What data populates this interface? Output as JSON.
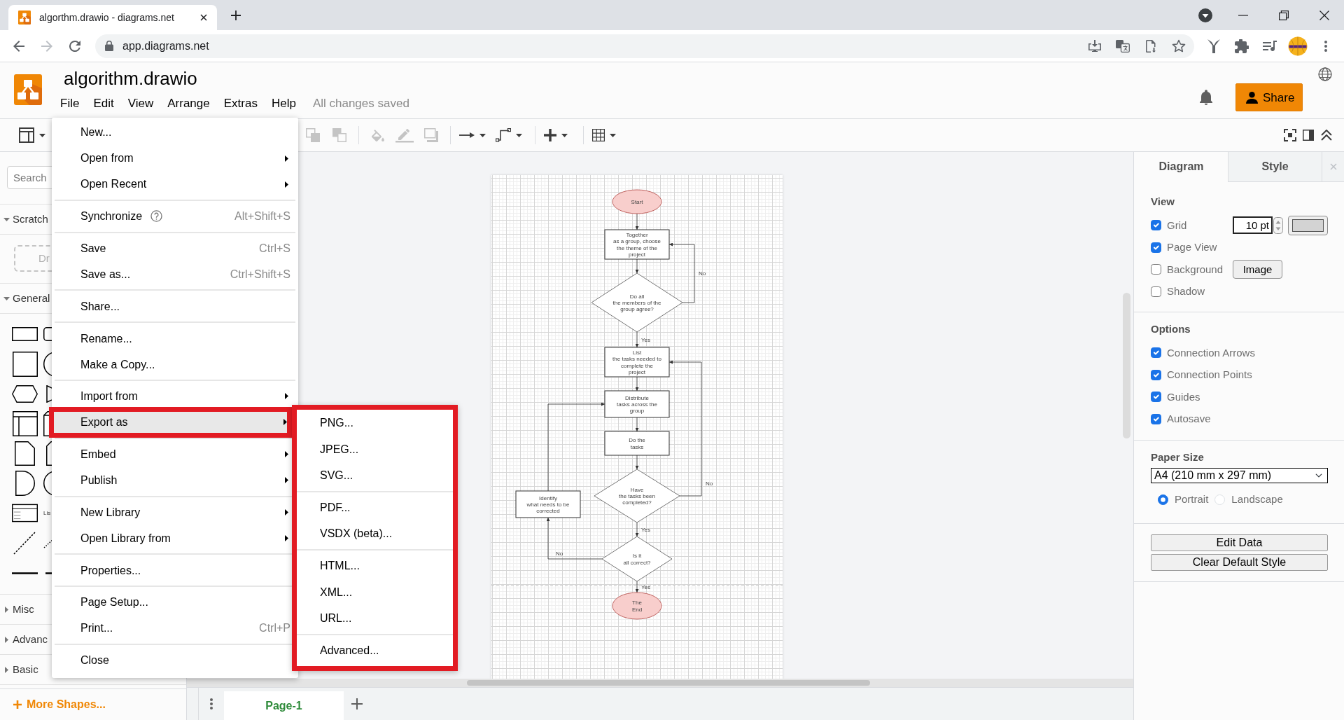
{
  "browser": {
    "tab": {
      "title": "algorthm.drawio - diagrams.net"
    },
    "nav_buttons": [
      {
        "kind": "back",
        "disabled": false
      },
      {
        "kind": "forward",
        "disabled": true
      },
      {
        "kind": "reload",
        "disabled": false
      }
    ],
    "url": "app.diagrams.net"
  },
  "app": {
    "title": "algorithm.drawio",
    "menus": [
      "File",
      "Edit",
      "View",
      "Arrange",
      "Extras",
      "Help"
    ],
    "save_status": "All changes saved",
    "share_button": "Share"
  },
  "toolbar": {
    "groups": [
      [
        {
          "kind": "format-panel",
          "disabled": false
        }
      ],
      [
        {
          "kind": "to-front",
          "disabled": true
        },
        {
          "kind": "to-back",
          "disabled": true
        }
      ],
      [
        {
          "kind": "fill-color",
          "disabled": true
        },
        {
          "kind": "line-color",
          "disabled": true
        },
        {
          "kind": "shadow",
          "disabled": true
        }
      ],
      [
        {
          "kind": "connection",
          "disabled": false
        },
        {
          "kind": "waypoints",
          "disabled": false
        }
      ],
      [
        {
          "kind": "insert",
          "disabled": false
        }
      ],
      [
        {
          "kind": "table",
          "disabled": false
        }
      ]
    ],
    "right": [
      {
        "kind": "fullscreen",
        "disabled": false
      },
      {
        "kind": "format-toggle",
        "disabled": false
      },
      {
        "kind": "collapse",
        "disabled": false
      }
    ]
  },
  "sidebar": {
    "search": {
      "placeholder": "Search"
    },
    "sections": [
      {
        "title": "Scratch",
        "expanded": true,
        "kind": "scratchpad",
        "hint": "Dr"
      },
      {
        "title": "General",
        "expanded": true,
        "kind": "shapes",
        "shape_label": "Lis"
      },
      {
        "title": "Misc",
        "expanded": false
      },
      {
        "title": "Advanc",
        "expanded": false
      },
      {
        "title": "Basic",
        "expanded": false
      }
    ],
    "more_shapes": "More Shapes..."
  },
  "diagram": {
    "nodes": [
      {
        "kind": "terminator",
        "text": "Start"
      },
      {
        "kind": "process",
        "text": "Together\nas a group, choose\nthe theme of the\nproject"
      },
      {
        "kind": "decision",
        "text": "Do all\nthe members of the\ngroup agree?"
      },
      {
        "kind": "process",
        "text": "List\nthe tasks needed to\ncomplete the\nproject"
      },
      {
        "kind": "process",
        "text": "Distribute\ntasks across the\ngroup"
      },
      {
        "kind": "process",
        "text": "Do the\ntasks"
      },
      {
        "kind": "decision",
        "text": "Have\nthe tasks been\ncompleted?"
      },
      {
        "kind": "process",
        "text": "Identify\nwhat needs to be\ncorrected"
      },
      {
        "kind": "decision",
        "text": "Is it\nall correct?"
      },
      {
        "kind": "terminator",
        "text": "The\nEnd"
      }
    ],
    "edge_labels": [
      "No",
      "Yes",
      "No",
      "Yes",
      "No",
      "Yes"
    ]
  },
  "page_tabs": [
    {
      "label": "Page-1",
      "selected": true
    }
  ],
  "format_panel": {
    "tabs": [
      {
        "label": "Diagram",
        "selected": true
      },
      {
        "label": "Style",
        "selected": false
      }
    ],
    "view": {
      "title": "View",
      "options": [
        {
          "label": "Grid",
          "checked": true,
          "kind": "grid",
          "value": "10 pt",
          "color": "#d3d3d3"
        },
        {
          "label": "Page View",
          "checked": true,
          "kind": "plain"
        },
        {
          "label": "Background",
          "checked": false,
          "kind": "image",
          "button": "Image"
        },
        {
          "label": "Shadow",
          "checked": false,
          "kind": "plain"
        }
      ]
    },
    "options": {
      "title": "Options",
      "options": [
        {
          "label": "Connection Arrows",
          "checked": true
        },
        {
          "label": "Connection Points",
          "checked": true
        },
        {
          "label": "Guides",
          "checked": true
        },
        {
          "label": "Autosave",
          "checked": true
        }
      ]
    },
    "paper": {
      "title": "Paper Size",
      "value": "A4 (210 mm x 297 mm)",
      "orientations": [
        {
          "label": "Portrait",
          "selected": true
        },
        {
          "label": "Landscape",
          "selected": false
        }
      ]
    },
    "buttons": [
      "Edit Data",
      "Clear Default Style"
    ]
  },
  "file_menu": {
    "groups": [
      [
        {
          "label": "New...",
          "kind": "command",
          "selected": false,
          "outlined": false
        },
        {
          "label": "Open from",
          "kind": "submenu",
          "selected": false,
          "outlined": false
        },
        {
          "label": "Open Recent",
          "kind": "submenu",
          "selected": false,
          "outlined": false
        }
      ],
      [
        {
          "label": "Synchronize",
          "kind": "help",
          "shortcut": "Alt+Shift+S",
          "selected": false,
          "outlined": false
        }
      ],
      [
        {
          "label": "Save",
          "kind": "command",
          "shortcut": "Ctrl+S",
          "selected": false,
          "outlined": false
        },
        {
          "label": "Save as...",
          "kind": "command",
          "shortcut": "Ctrl+Shift+S",
          "selected": false,
          "outlined": false
        }
      ],
      [
        {
          "label": "Share...",
          "kind": "command",
          "selected": false,
          "outlined": false
        }
      ],
      [
        {
          "label": "Rename...",
          "kind": "command",
          "selected": false,
          "outlined": false
        },
        {
          "label": "Make a Copy...",
          "kind": "command",
          "selected": false,
          "outlined": false
        }
      ],
      [
        {
          "label": "Import from",
          "kind": "submenu",
          "selected": false,
          "outlined": false
        },
        {
          "label": "Export as",
          "kind": "submenu",
          "selected": true,
          "outlined": true
        }
      ],
      [
        {
          "label": "Embed",
          "kind": "submenu",
          "selected": false,
          "outlined": false
        },
        {
          "label": "Publish",
          "kind": "submenu",
          "selected": false,
          "outlined": false
        }
      ],
      [
        {
          "label": "New Library",
          "kind": "submenu",
          "selected": false,
          "outlined": false
        },
        {
          "label": "Open Library from",
          "kind": "submenu",
          "selected": false,
          "outlined": false
        }
      ],
      [
        {
          "label": "Properties...",
          "kind": "command",
          "selected": false,
          "outlined": false
        }
      ],
      [
        {
          "label": "Page Setup...",
          "kind": "command",
          "selected": false,
          "outlined": false
        },
        {
          "label": "Print...",
          "kind": "command",
          "shortcut": "Ctrl+P",
          "selected": false,
          "outlined": false
        }
      ],
      [
        {
          "label": "Close",
          "kind": "command",
          "selected": false,
          "outlined": false
        }
      ]
    ]
  },
  "export_submenu": {
    "outlined": true,
    "groups": [
      [
        "PNG...",
        "JPEG...",
        "SVG..."
      ],
      [
        "PDF...",
        "VSDX (beta)..."
      ],
      [
        "HTML...",
        "XML...",
        "URL..."
      ],
      [
        "Advanced..."
      ]
    ]
  }
}
